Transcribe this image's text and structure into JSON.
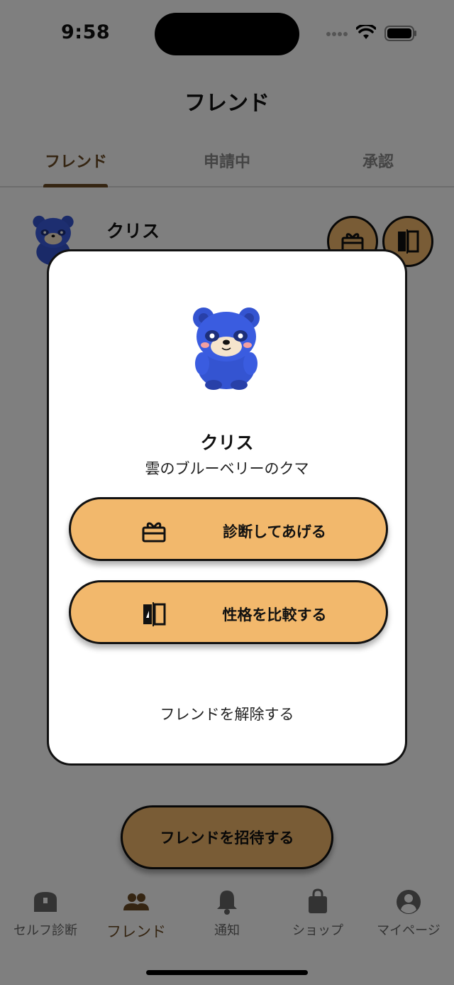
{
  "status_bar": {
    "time": "9:58"
  },
  "header": {
    "title": "フレンド"
  },
  "tabs": [
    {
      "label": "フレンド",
      "active": true
    },
    {
      "label": "申請中",
      "active": false
    },
    {
      "label": "承認",
      "active": false
    }
  ],
  "friend_row": {
    "name": "クリス"
  },
  "invite_button": {
    "label": "フレンドを招待する"
  },
  "tabbar": {
    "items": [
      {
        "label": "セルフ診断",
        "icon": "treasure-chest-icon"
      },
      {
        "label": "フレンド",
        "icon": "people-icon",
        "active": true
      },
      {
        "label": "通知",
        "icon": "bell-icon"
      },
      {
        "label": "ショップ",
        "icon": "shopping-bag-icon"
      },
      {
        "label": "マイページ",
        "icon": "user-circle-icon"
      }
    ]
  },
  "modal": {
    "name": "クリス",
    "subtitle": "雲のブルーベリーのクマ",
    "diagnose_button": {
      "label": "診断してあげる",
      "icon": "gift-box-icon"
    },
    "compare_button": {
      "label": "性格を比較する",
      "icon": "compare-icon"
    },
    "unfriend_label": "フレンドを解除する"
  },
  "colors": {
    "accent": "#f2b86c",
    "brand_brown": "#6b4a24",
    "bear_blue": "#3454d1"
  }
}
